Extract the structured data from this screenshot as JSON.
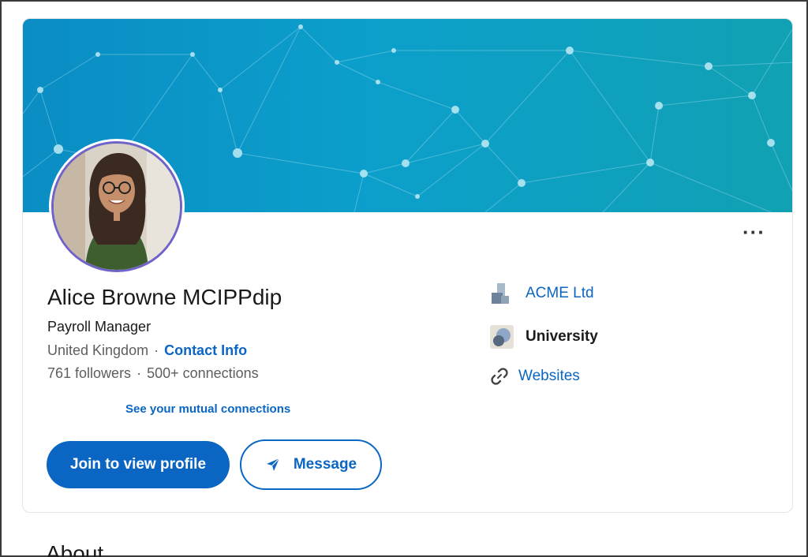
{
  "profile": {
    "name": "Alice Browne MCIPPdip",
    "headline": "Payroll Manager",
    "location": "United Kingdom",
    "contact_info_label": "Contact Info",
    "followers": "761 followers",
    "connections": "500+ connections",
    "mutual_connections_label": "See your mutual connections",
    "separator": "·"
  },
  "actions": {
    "join_label": "Join to view profile",
    "message_label": "Message",
    "more_label": "···"
  },
  "sidebar": {
    "company": "ACME Ltd",
    "education": "University",
    "websites": "Websites"
  },
  "sections": {
    "about_heading": "About"
  },
  "colors": {
    "brand_blue": "#0a66c2",
    "banner_start": "#0a8dc4",
    "banner_end": "#11a1b3",
    "avatar_ring": "#6f63c9"
  },
  "icons": {
    "more": "more-horizontal-icon",
    "message": "send-icon",
    "company": "company-logo-icon",
    "education": "school-logo-icon",
    "websites": "link-icon"
  }
}
